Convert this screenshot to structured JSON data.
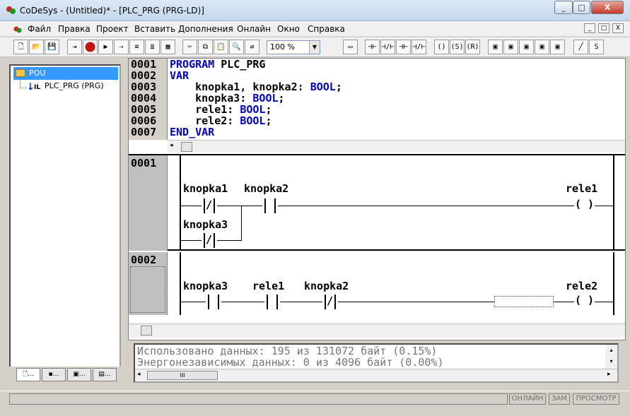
{
  "window": {
    "title": "CoDeSys - (Untitled)* - [PLC_PRG (PRG-LD)]",
    "minimize": "_",
    "maximize": "□",
    "close": "X"
  },
  "menu": {
    "items": [
      "Файл",
      "Правка",
      "Проект",
      "Вставить",
      "Дополнения",
      "Онлайн",
      "Окно",
      "Справка"
    ],
    "mdi": [
      "_",
      "□",
      "X"
    ]
  },
  "toolbar": {
    "zoom": "100 %"
  },
  "tree": {
    "root": "POU",
    "child": "PLC_PRG (PRG)"
  },
  "declaration": {
    "line_numbers": [
      "0001",
      "0002",
      "0003",
      "0004",
      "0005",
      "0006",
      "0007"
    ],
    "lines": [
      {
        "kw": "PROGRAM",
        "rest": " PLC_PRG"
      },
      {
        "kw": "VAR",
        "rest": ""
      },
      {
        "kw": "",
        "rest": "    knopka1, knopka2: ",
        "type": "BOOL",
        "tail": ";"
      },
      {
        "kw": "",
        "rest": "    knopka3: ",
        "type": "BOOL",
        "tail": ";"
      },
      {
        "kw": "",
        "rest": "    rele1: ",
        "type": "BOOL",
        "tail": ";"
      },
      {
        "kw": "",
        "rest": "    rele2: ",
        "type": "BOOL",
        "tail": ";"
      },
      {
        "kw": "END_VAR",
        "rest": ""
      }
    ]
  },
  "ladder": {
    "networks": [
      {
        "number": "0001",
        "contacts": [
          "knopka1",
          "knopka2",
          "knopka3"
        ],
        "coil": "rele1",
        "nc_symbol": "/",
        "coil_symbol": "( )"
      },
      {
        "number": "0002",
        "contacts": [
          "knopka3",
          "rele1",
          "knopka2"
        ],
        "coil": "rele2",
        "nc_symbol": "/",
        "coil_symbol": "( )"
      }
    ]
  },
  "messages": [
    "Использовано данных: 195 из 131072 байт (0.15%)",
    "Энергонезависимых данных: 0 из 4096 байт (0.00%)"
  ],
  "status": [
    "ОНЛАЙН",
    "ЗАМ",
    "ПРОСМОТР"
  ],
  "icons": [
    "app-icon",
    "new-icon",
    "open-icon",
    "save-icon",
    "stop-icon",
    "run-icon",
    "cut-icon",
    "copy-icon",
    "paste-icon",
    "find-icon",
    "contact-icon",
    "coil-icon",
    "box-icon",
    "folder-icon",
    "program-icon"
  ]
}
